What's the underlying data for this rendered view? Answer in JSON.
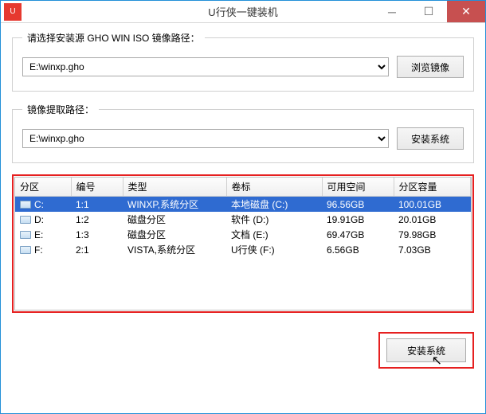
{
  "window": {
    "title": "U行侠一键装机",
    "icon_label": "U"
  },
  "section1": {
    "legend": "请选择安装源 GHO WIN ISO 镜像路径：",
    "combo_value": "E:\\winxp.gho",
    "browse_label": "浏览镜像"
  },
  "section2": {
    "legend": "镜像提取路径：",
    "combo_value": "E:\\winxp.gho",
    "install_label": "安装系统"
  },
  "table": {
    "headers": {
      "partition": "分区",
      "number": "编号",
      "type": "类型",
      "volume": "卷标",
      "free": "可用空间",
      "capacity": "分区容量"
    },
    "rows": [
      {
        "part": "C:",
        "num": "1:1",
        "type": "WINXP,系统分区",
        "vol": "本地磁盘 (C:)",
        "free": "96.56GB",
        "cap": "100.01GB",
        "selected": true
      },
      {
        "part": "D:",
        "num": "1:2",
        "type": "磁盘分区",
        "vol": "软件 (D:)",
        "free": "19.91GB",
        "cap": "20.01GB",
        "selected": false
      },
      {
        "part": "E:",
        "num": "1:3",
        "type": "磁盘分区",
        "vol": "文档 (E:)",
        "free": "69.47GB",
        "cap": "79.98GB",
        "selected": false
      },
      {
        "part": "F:",
        "num": "2:1",
        "type": "VISTA,系统分区",
        "vol": "U行侠 (F:)",
        "free": "6.56GB",
        "cap": "7.03GB",
        "selected": false
      }
    ]
  },
  "bottom": {
    "install_label": "安装系统"
  },
  "colors": {
    "highlight": "#e62020",
    "selection": "#2f6bd1",
    "title_accent": "#2390d8"
  }
}
